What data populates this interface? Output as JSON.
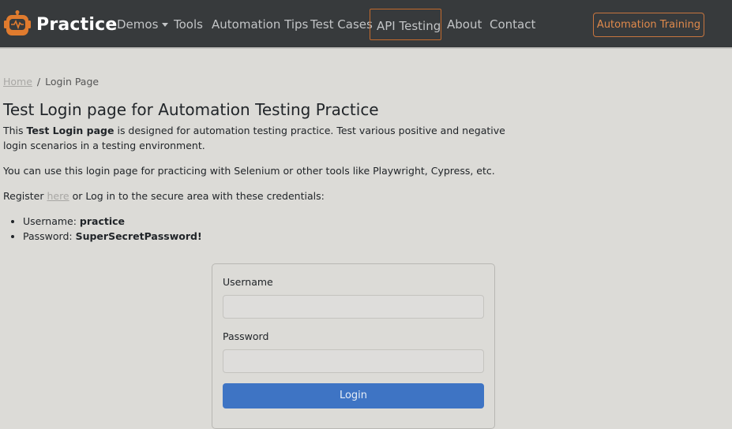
{
  "navbar": {
    "brand": "Practice",
    "links": {
      "demos": "Demos",
      "tools": "Tools",
      "automation_tips": "Automation Tips",
      "test_cases": "Test Cases",
      "api_testing": "API Testing",
      "about": "About",
      "contact": "Contact"
    },
    "cta": "Automation Training"
  },
  "breadcrumb": {
    "home": "Home",
    "separator": "/",
    "current": "Login Page"
  },
  "page": {
    "title": "Test Login page for Automation Testing Practice",
    "intro": {
      "prefix": "This ",
      "bold": "Test Login page",
      "suffix": " is designed for automation testing practice. Test various positive and negative login scenarios in a testing environment."
    },
    "para2": "You can use this login page for practicing with Selenium or other tools like Playwright, Cypress, etc.",
    "para3": {
      "prefix": "Register ",
      "link": "here",
      "suffix": " or Log in to the secure area with these credentials:"
    },
    "credentials": {
      "username_label": "Username: ",
      "username_value": "practice",
      "password_label": "Password: ",
      "password_value": "SuperSecretPassword!"
    }
  },
  "login_form": {
    "username_label": "Username",
    "username_value": "",
    "password_label": "Password",
    "password_value": "",
    "submit_label": "Login"
  },
  "colors": {
    "navbar_bg": "#373a3c",
    "accent_orange": "#c7753f",
    "page_bg": "#dcdbd7",
    "primary_button": "#3e74c4"
  }
}
